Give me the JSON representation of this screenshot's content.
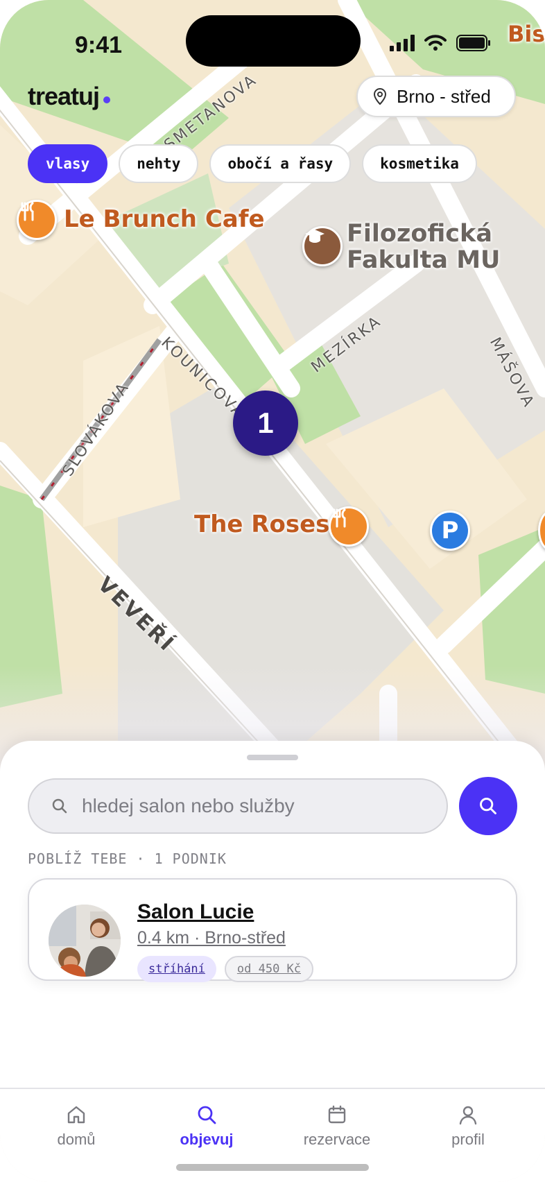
{
  "status_bar": {
    "time": "9:41"
  },
  "header": {
    "logo": "treatuj",
    "location_button": {
      "label": "Brno - střed",
      "icon": "location-pin-icon"
    }
  },
  "categories": [
    {
      "label": "vlasy",
      "active": true
    },
    {
      "label": "nehty",
      "active": false
    },
    {
      "label": "obočí a řasy",
      "active": false
    },
    {
      "label": "kosmetika",
      "active": false
    }
  ],
  "map": {
    "places": {
      "brunch": "Le Brunch Cafe",
      "faculty_line1": "Filozofická",
      "faculty_line2": "Fakulta MU",
      "roses": "The Roses",
      "corner_cut": "Bis"
    },
    "streets": {
      "smetanova": "SMETANOVA",
      "mezirka": "MEZÍRKA",
      "kounicova": "KOUNICOVA",
      "slovakova": "SLOVÁKOVA",
      "veveri": "VEVEŘÍ",
      "masova": "MÁŠOVA"
    },
    "cluster_count": "1",
    "parking_symbol": "P"
  },
  "sheet": {
    "search": {
      "placeholder": "hledej salon nebo služby"
    },
    "nearby_label": "POBLÍŽ TEBE · 1 PODNIK",
    "results": [
      {
        "name": "Salon Lucie",
        "meta": "0.4 km · Brno-střed",
        "service_tag": "stříhání",
        "price_tag": "od 450 Kč"
      }
    ]
  },
  "tabbar": {
    "home": "domů",
    "explore": "objevuj",
    "bookings": "rezervace",
    "profile": "profil"
  },
  "colors": {
    "accent": "#4b32f5",
    "cluster": "#2b1a86",
    "map_building": "#f4e8cf",
    "map_park": "#b9dca0",
    "map_road": "#ffffff"
  }
}
